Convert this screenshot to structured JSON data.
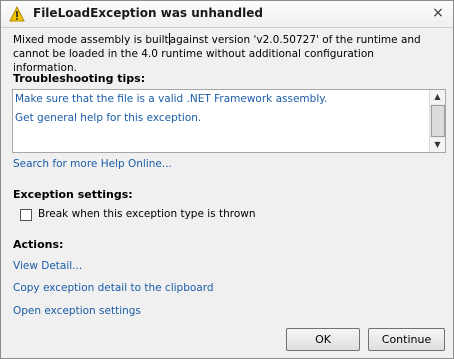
{
  "dialog": {
    "title": "FileLoadException was unhandled",
    "close_glyph": "×",
    "message_part1": "Mixed mode assembly is built",
    "message_part2": "against version 'v2.0.50727' of the runtime and cannot be loaded in the 4.0 runtime without additional configuration information."
  },
  "troubleshooting": {
    "label": "Troubleshooting tips:",
    "tips": [
      "Make sure that the file is a valid .NET Framework assembly.",
      "Get general help for this exception."
    ],
    "search_link": "Search for more Help Online..."
  },
  "exception_settings": {
    "label": "Exception settings:",
    "checkbox_label": "Break when this exception type is thrown",
    "checked": false
  },
  "actions": {
    "label": "Actions:",
    "items": [
      "View Detail...",
      "Copy exception detail to the clipboard",
      "Open exception settings"
    ]
  },
  "buttons": {
    "ok": "OK",
    "continue": "Continue"
  },
  "colors": {
    "link": "#1a5ca8",
    "warning": "#f5c400"
  },
  "icons": {
    "title": "warning-icon",
    "close": "close-icon",
    "scroll_up": "scroll-up-icon",
    "scroll_down": "scroll-down-icon"
  }
}
